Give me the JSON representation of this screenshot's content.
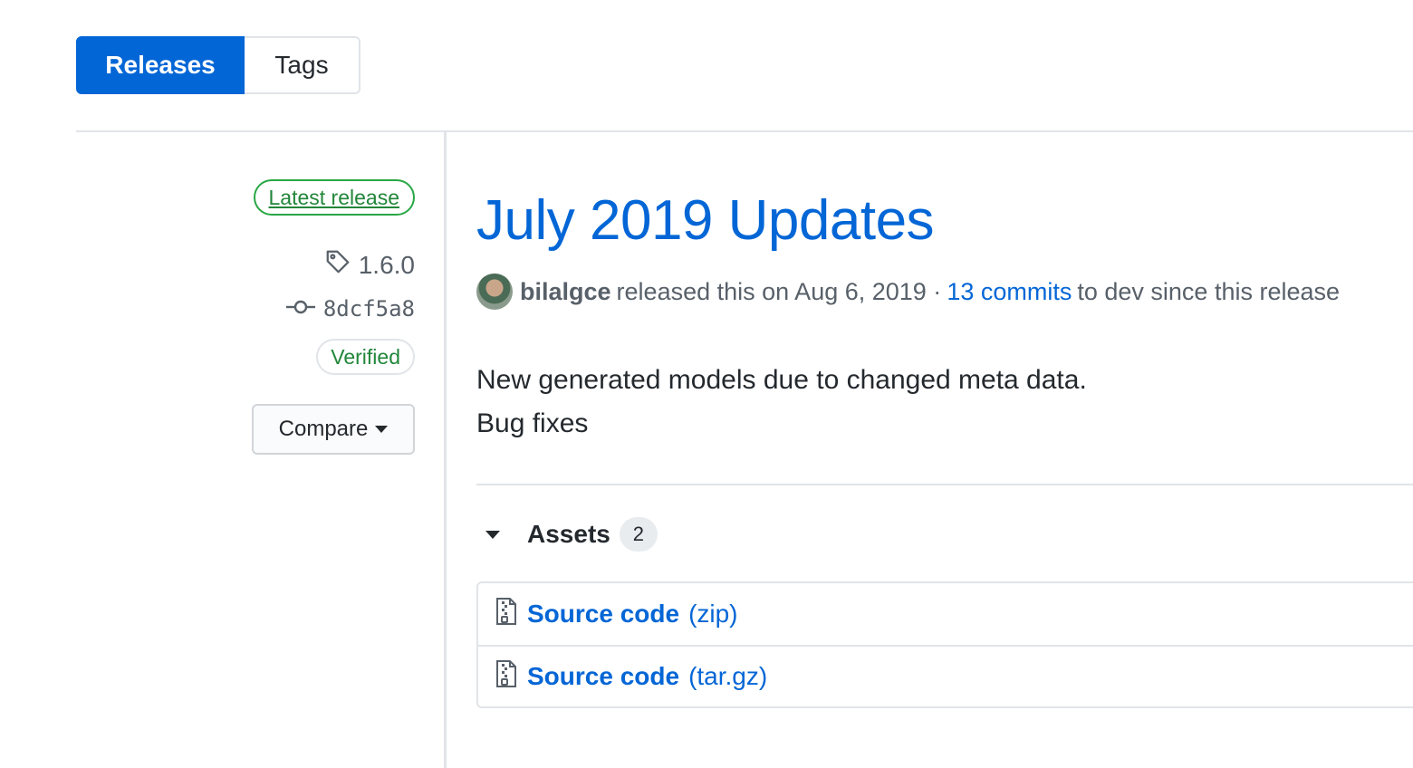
{
  "tabs": [
    {
      "label": "Releases",
      "active": true
    },
    {
      "label": "Tags",
      "active": false
    }
  ],
  "sidebar": {
    "latest_label": "Latest release",
    "tag": "1.6.0",
    "commit": "8dcf5a8",
    "verified_label": "Verified",
    "compare_label": "Compare"
  },
  "release": {
    "title": "July 2019 Updates",
    "author": "bilalgce",
    "released_text": "released this on Aug 6, 2019 ·",
    "commits_link": "13 commits",
    "commits_suffix": "to dev since this release",
    "body_lines": [
      "New generated models due to changed meta data.",
      "Bug fixes"
    ]
  },
  "assets": {
    "label": "Assets",
    "count": "2",
    "items": [
      {
        "name": "Source code",
        "ext": "(zip)",
        "icon": "file-zip-icon"
      },
      {
        "name": "Source code",
        "ext": "(tar.gz)",
        "icon": "file-zip-icon"
      }
    ]
  },
  "colors": {
    "accent": "#0366d6",
    "success": "#28a745",
    "border": "#e1e4e8"
  }
}
